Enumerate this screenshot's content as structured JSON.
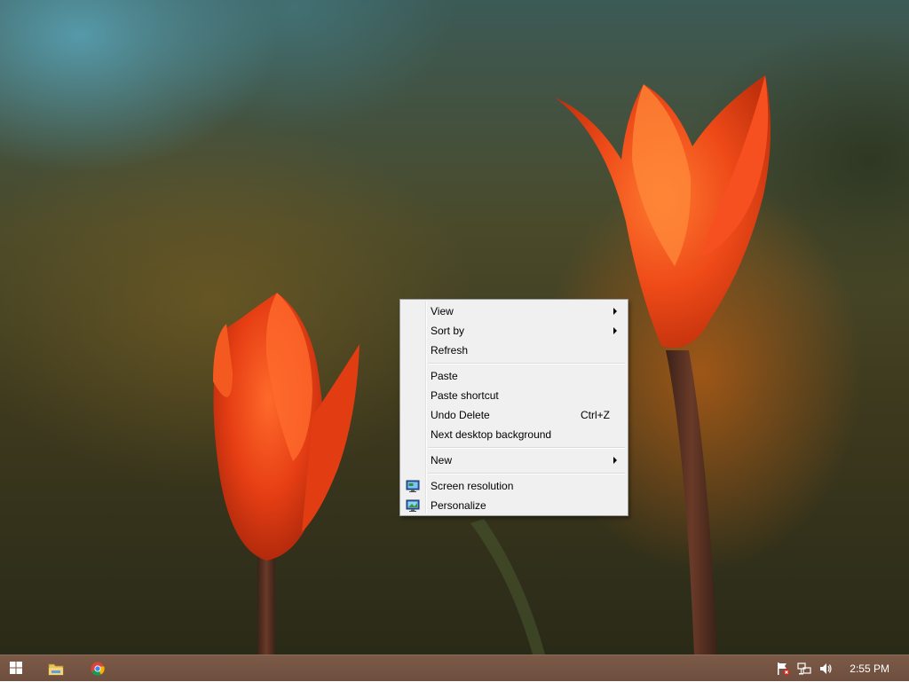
{
  "context_menu": {
    "items": [
      {
        "label": "View",
        "submenu": true
      },
      {
        "label": "Sort by",
        "submenu": true
      },
      {
        "label": "Refresh"
      },
      {
        "label": "Paste"
      },
      {
        "label": "Paste shortcut"
      },
      {
        "label": "Undo Delete",
        "shortcut": "Ctrl+Z"
      },
      {
        "label": "Next desktop background"
      },
      {
        "label": "New",
        "submenu": true
      },
      {
        "label": "Screen resolution",
        "icon": "screen-resolution-icon"
      },
      {
        "label": "Personalize",
        "icon": "personalize-icon"
      }
    ]
  },
  "taskbar": {
    "pinned": [
      {
        "name": "start",
        "icon": "windows-logo-icon"
      },
      {
        "name": "file-explorer",
        "icon": "folder-icon"
      },
      {
        "name": "chrome",
        "icon": "chrome-icon"
      }
    ],
    "tray_icons": [
      "action-center-flag-icon",
      "network-icon",
      "volume-icon"
    ],
    "clock": "2:55 PM"
  },
  "colors": {
    "menu_bg": "#f0f0f0",
    "menu_border": "#a0a0a0",
    "taskbar_bg": "#74533f",
    "tulip": "#e8401a"
  }
}
